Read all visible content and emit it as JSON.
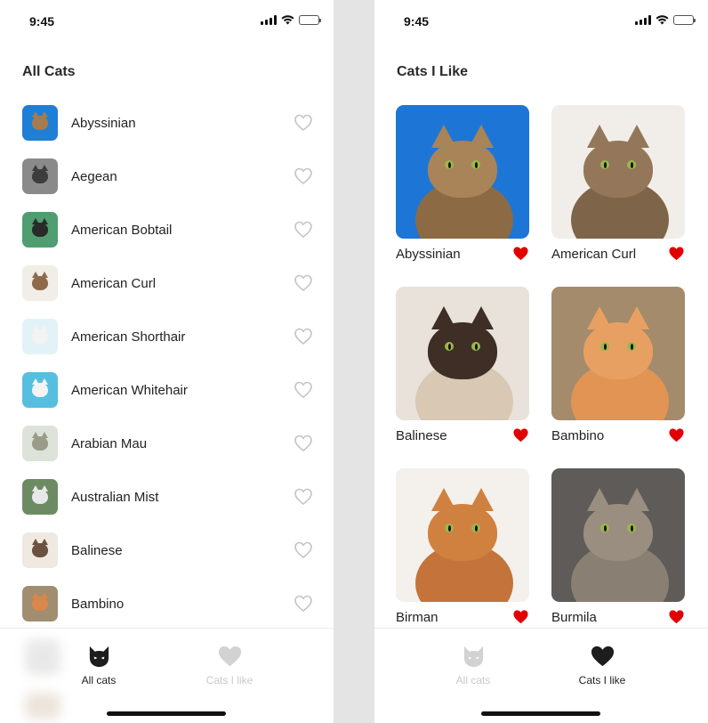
{
  "status_bar": {
    "time": "9:45"
  },
  "all_cats_screen": {
    "title": "All Cats",
    "cats": [
      {
        "name": "Abyssinian",
        "liked": false,
        "thumb": {
          "bg": "#1f7fd6",
          "fur": "#a47c4f"
        }
      },
      {
        "name": "Aegean",
        "liked": false,
        "thumb": {
          "bg": "#8a8a8a",
          "fur": "#3d3d3d"
        }
      },
      {
        "name": "American Bobtail",
        "liked": false,
        "thumb": {
          "bg": "#4f9d70",
          "fur": "#2a2a2a"
        }
      },
      {
        "name": "American Curl",
        "liked": false,
        "thumb": {
          "bg": "#f1ede7",
          "fur": "#8e6a4b"
        }
      },
      {
        "name": "American Shorthair",
        "liked": false,
        "thumb": {
          "bg": "#e3f2f7",
          "fur": "#f3f3f3"
        }
      },
      {
        "name": "American Whitehair",
        "liked": false,
        "thumb": {
          "bg": "#56bfe0",
          "fur": "#f4f4f4"
        }
      },
      {
        "name": "Arabian Mau",
        "liked": false,
        "thumb": {
          "bg": "#dde3da",
          "fur": "#9b9b8a"
        }
      },
      {
        "name": "Australian Mist",
        "liked": false,
        "thumb": {
          "bg": "#6d8b63",
          "fur": "#e8e8e8"
        }
      },
      {
        "name": "Balinese",
        "liked": false,
        "thumb": {
          "bg": "#efe9e1",
          "fur": "#6b5140"
        }
      },
      {
        "name": "Bambino",
        "liked": false,
        "thumb": {
          "bg": "#a18d70",
          "fur": "#d8884a"
        }
      }
    ]
  },
  "liked_cats_screen": {
    "title": "Cats I Like",
    "cats": [
      {
        "name": "Abyssinian",
        "liked": true,
        "photo": {
          "bg": "#1d76d6",
          "fur": "#8c6a44",
          "face": "#a88458"
        }
      },
      {
        "name": "American Curl",
        "liked": true,
        "photo": {
          "bg": "#f1eeea",
          "fur": "#7e6449",
          "face": "#94775a"
        }
      },
      {
        "name": "Balinese",
        "liked": true,
        "photo": {
          "bg": "#e8e2da",
          "fur": "#d8c8b4",
          "face": "#3e2e26"
        }
      },
      {
        "name": "Bambino",
        "liked": true,
        "photo": {
          "bg": "#a48b6c",
          "fur": "#e19454",
          "face": "#e8a062"
        }
      },
      {
        "name": "Birman",
        "liked": true,
        "photo": {
          "bg": "#f4f0ec",
          "fur": "#c4743a",
          "face": "#d0813f"
        }
      },
      {
        "name": "Burmila",
        "liked": true,
        "photo": {
          "bg": "#5e5b58",
          "fur": "#8a7f73",
          "face": "#9a8e80"
        }
      }
    ]
  },
  "tab_bar": {
    "tabs": [
      {
        "label": "All cats",
        "icon": "cat-head-icon"
      },
      {
        "label": "Cats I like",
        "icon": "heart-icon"
      }
    ]
  },
  "colors": {
    "heart_filled": "#e10000",
    "heart_outline": "#c4c4c4",
    "tab_active": "#1d1d1d",
    "tab_inactive": "#c9c9c9",
    "divider_gap": "#e4e4e4"
  }
}
